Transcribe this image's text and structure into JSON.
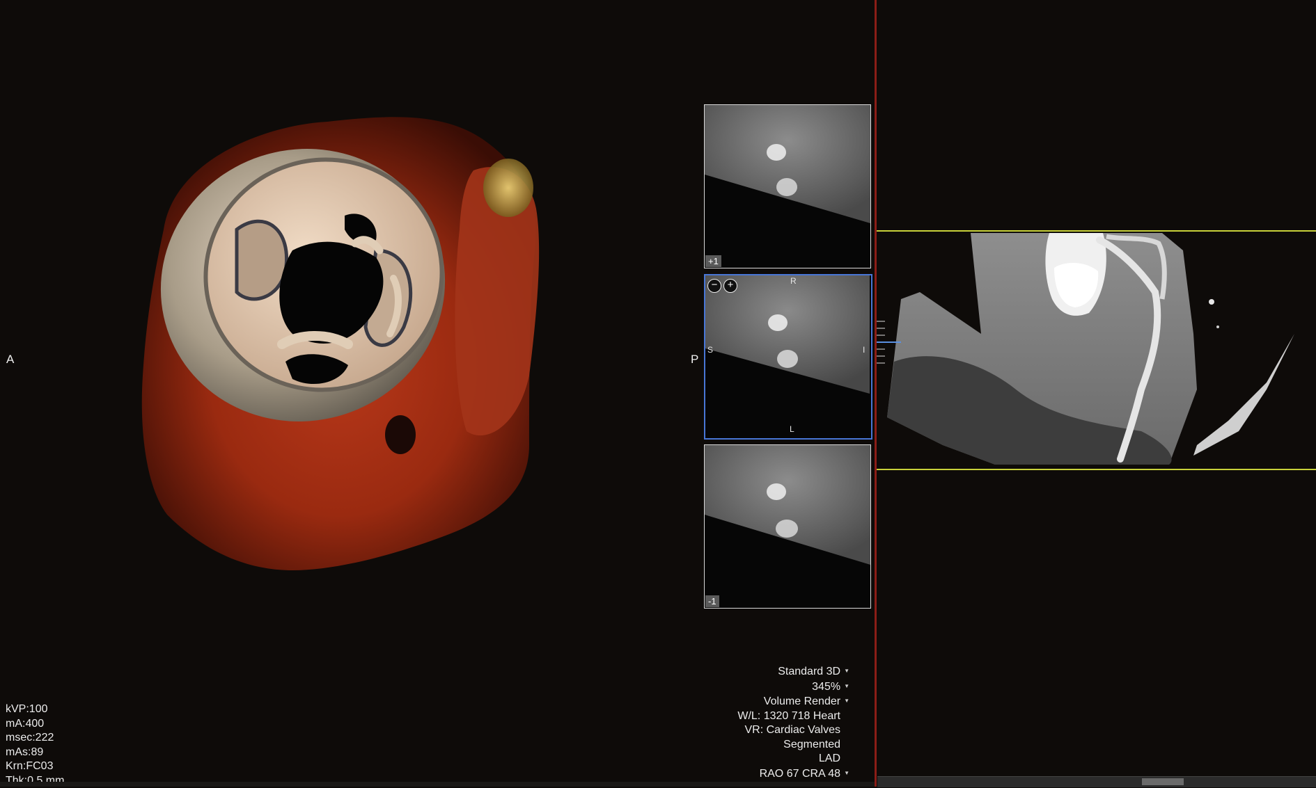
{
  "viewport_3d": {
    "orientation_left": "A",
    "orientation_right": "P"
  },
  "acquisition": {
    "kvp": "kVP:100",
    "ma": "mA:400",
    "msec": "msec:222",
    "mas": "mAs:89",
    "kernel": "Krn:FC03",
    "thickness": "Thk:0.5 mm"
  },
  "render_settings": {
    "preset": "Standard 3D",
    "zoom": "345%",
    "mode": "Volume Render",
    "window_level": "W/L: 1320 718 Heart",
    "vr_preset": "VR: Cardiac Valves",
    "segmentation": "Segmented",
    "vessel": "LAD",
    "projection": "RAO 67  CRA 48"
  },
  "slices": {
    "top_badge": "+1",
    "bottom_badge": "-1",
    "center": {
      "zoom_out": "−",
      "zoom_in": "+",
      "top": "R",
      "left": "S",
      "right": "I",
      "bottom": "L"
    }
  },
  "colors": {
    "divider": "#8b1d17",
    "active_slice_border": "#4876d6",
    "guide_line": "#c9d23a"
  }
}
